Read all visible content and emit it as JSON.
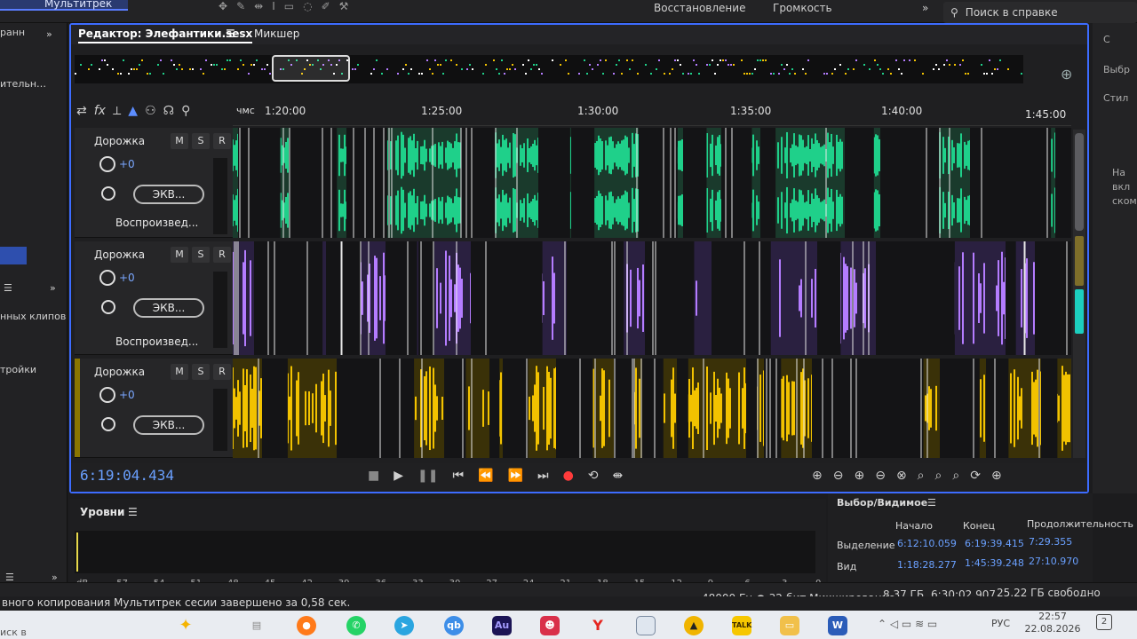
{
  "topbar": {
    "workspace_tab": "Мультитрек",
    "restore_button": "Восстановление",
    "loudness_button": "Громкость",
    "search_placeholder": "Поиск в справке"
  },
  "left_panel": {
    "label_1": "ранн",
    "label_2": "ительн…",
    "label_3": "нных клипов",
    "label_4": "тройки"
  },
  "right_panel": {
    "label_1": "Выбр",
    "label_2": "Стил",
    "label_3": "На",
    "label_4": "вкл",
    "label_5": "ском"
  },
  "editor": {
    "tab_editor": "Редактор: Элефантики.sesx",
    "tab_mixer": "Микшер",
    "ruler_unit": "чмс",
    "ruler_ticks": [
      "1:20:00",
      "1:25:00",
      "1:30:00",
      "1:35:00",
      "1:40:00",
      "1:45:00"
    ],
    "tracks": [
      {
        "name": "Дорожка",
        "volume": "+0",
        "fx_label": "ЭКВ...",
        "output": "Воспроизвед...",
        "color": "#1fd08a"
      },
      {
        "name": "Дорожка",
        "volume": "+0",
        "fx_label": "ЭКВ...",
        "output": "Воспроизвед...",
        "color": "#b47cff"
      },
      {
        "name": "Дорожка",
        "volume": "+0",
        "fx_label": "ЭКВ...",
        "output": "",
        "color": "#f2c200"
      }
    ],
    "mute_label": "M",
    "solo_label": "S",
    "rec_label": "R",
    "timecode": "6:19:04.434"
  },
  "levels": {
    "title": "Уровни",
    "scale": [
      "dB",
      "-57",
      "-54",
      "-51",
      "-48",
      "-45",
      "-42",
      "-39",
      "-36",
      "-33",
      "-30",
      "-27",
      "-24",
      "-21",
      "-18",
      "-15",
      "-12",
      "-9",
      "-6",
      "-3",
      "0"
    ]
  },
  "selection_view": {
    "title": "Выбор/Видимое",
    "col_start": "Начало",
    "col_end": "Конец",
    "col_duration": "Продолжительность",
    "row_selection": "Выделение",
    "row_view": "Вид",
    "selection_start": "6:12:10.059",
    "selection_end": "6:19:39.415",
    "selection_duration": "7:29.355",
    "view_start": "1:18:28.277",
    "view_end": "1:45:39.248",
    "view_duration": "27:10.970"
  },
  "statusbar": {
    "message": "вного копирования Мультитрек сесии завершено за 0,58 сек.",
    "format": "48000 Гц ● 32-бит Микширование",
    "size": "8,37 ГБ",
    "duration": "6:30:02.907",
    "free": "25,22 ГБ свободно"
  },
  "taskbar": {
    "search_label": "иск в",
    "lang": "РУС",
    "time": "22:57",
    "date": "22.08.2026",
    "notif_count": "2",
    "apps": [
      "firefox",
      "whatsapp",
      "telegram",
      "qb",
      "Au",
      "app-red",
      "yandex",
      "window",
      "app-warn",
      "talk",
      "folder",
      "word"
    ]
  }
}
